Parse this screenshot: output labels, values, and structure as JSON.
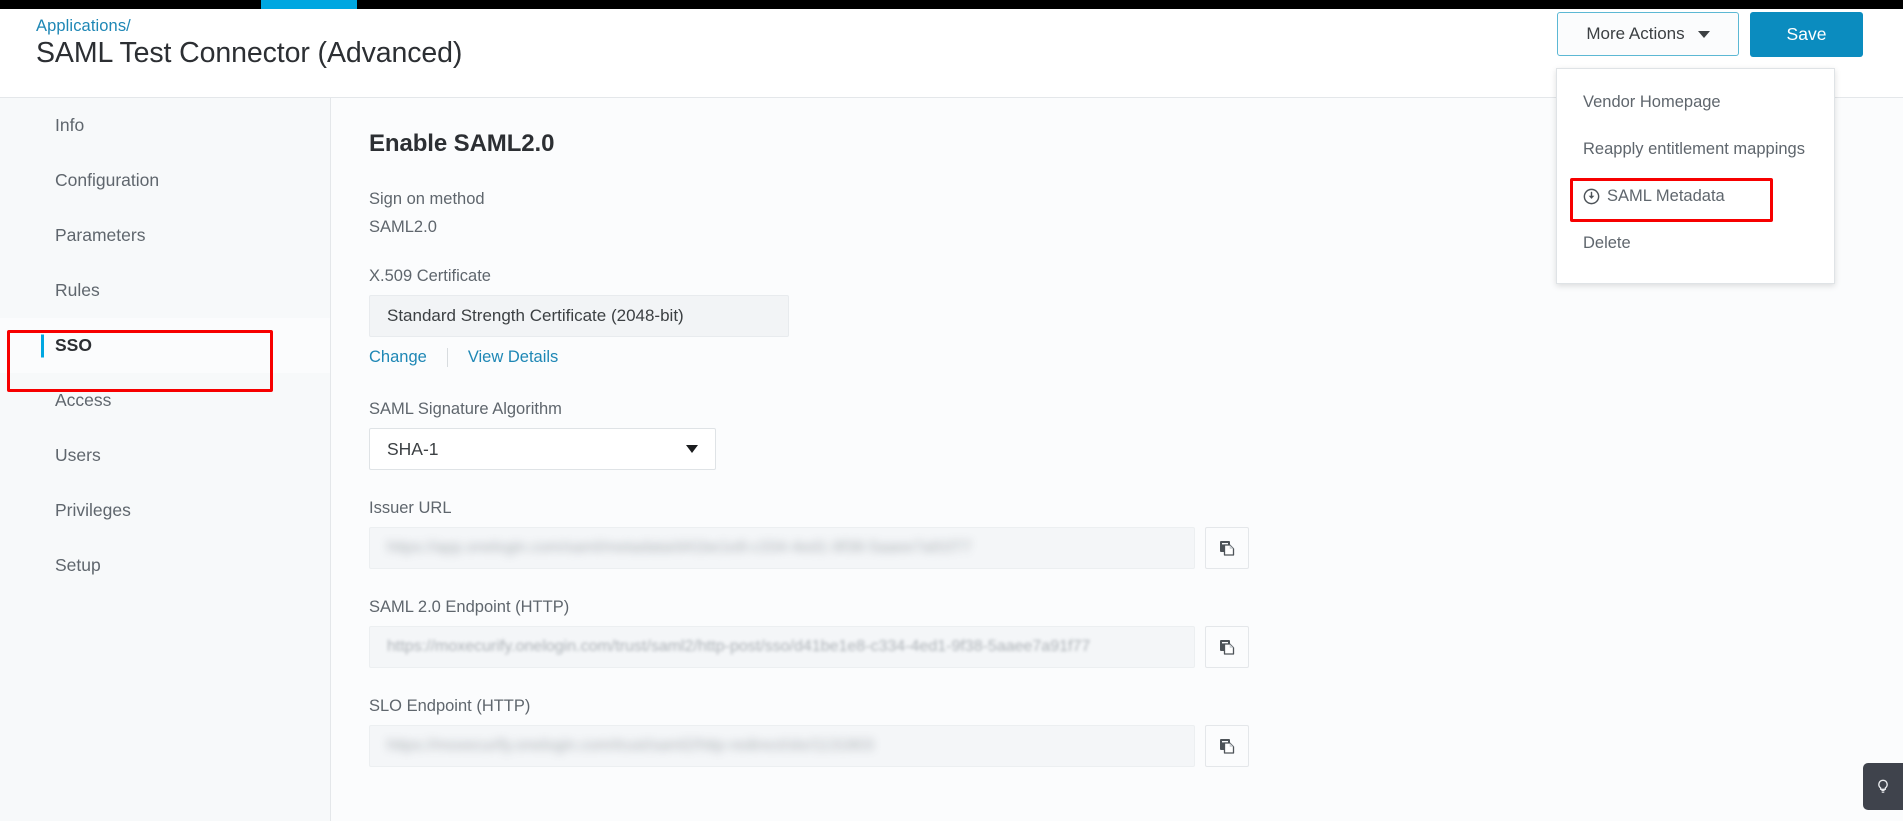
{
  "colors": {
    "accent_blue": "#00a7e1",
    "save_button": "#0b8cbf",
    "link": "#1e87b5",
    "highlight_red": "#f70000",
    "sidebar_bg": "#f7f9fa"
  },
  "header": {
    "breadcrumb_link": "Applications",
    "breadcrumb_separator": "/",
    "title": "SAML Test Connector (Advanced)",
    "more_actions_label": "More Actions",
    "save_label": "Save"
  },
  "dropdown": {
    "items": [
      {
        "label": "Vendor Homepage",
        "icon": "",
        "highlighted": false
      },
      {
        "label": "Reapply entitlement mappings",
        "icon": "",
        "highlighted": false
      },
      {
        "label": "SAML Metadata",
        "icon": "download-circle-icon",
        "highlighted": true
      },
      {
        "label": "Delete",
        "icon": "",
        "highlighted": false
      }
    ]
  },
  "sidebar": {
    "items": [
      {
        "label": "Info",
        "active": false
      },
      {
        "label": "Configuration",
        "active": false
      },
      {
        "label": "Parameters",
        "active": false
      },
      {
        "label": "Rules",
        "active": false
      },
      {
        "label": "SSO",
        "active": true
      },
      {
        "label": "Access",
        "active": false
      },
      {
        "label": "Users",
        "active": false
      },
      {
        "label": "Privileges",
        "active": false
      },
      {
        "label": "Setup",
        "active": false
      }
    ]
  },
  "main": {
    "section_title": "Enable SAML2.0",
    "sign_on_method": {
      "label": "Sign on method",
      "value": "SAML2.0"
    },
    "certificate": {
      "label": "X.509 Certificate",
      "value": "Standard Strength Certificate (2048-bit)",
      "change_link": "Change",
      "view_details_link": "View Details"
    },
    "signature_algorithm": {
      "label": "SAML Signature Algorithm",
      "value": "SHA-1"
    },
    "issuer_url": {
      "label": "Issuer URL",
      "value": "https://app.onelogin.com/saml/metadata/d41be1e8-c334-4ed1-9f38-5aaee7a91f77",
      "copy_icon": "copy-icon"
    },
    "saml_endpoint": {
      "label": "SAML 2.0 Endpoint (HTTP)",
      "value": "https://moxecurify.onelogin.com/trust/saml2/http-post/sso/d41be1e8-c334-4ed1-9f38-5aaee7a91f77",
      "copy_icon": "copy-icon"
    },
    "slo_endpoint": {
      "label": "SLO Endpoint (HTTP)",
      "value": "https://moxecurify.onelogin.com/trust/saml2/http-redirect/slo/1131803",
      "copy_icon": "copy-icon"
    }
  },
  "help_widget": {
    "icon": "lightbulb-icon"
  }
}
